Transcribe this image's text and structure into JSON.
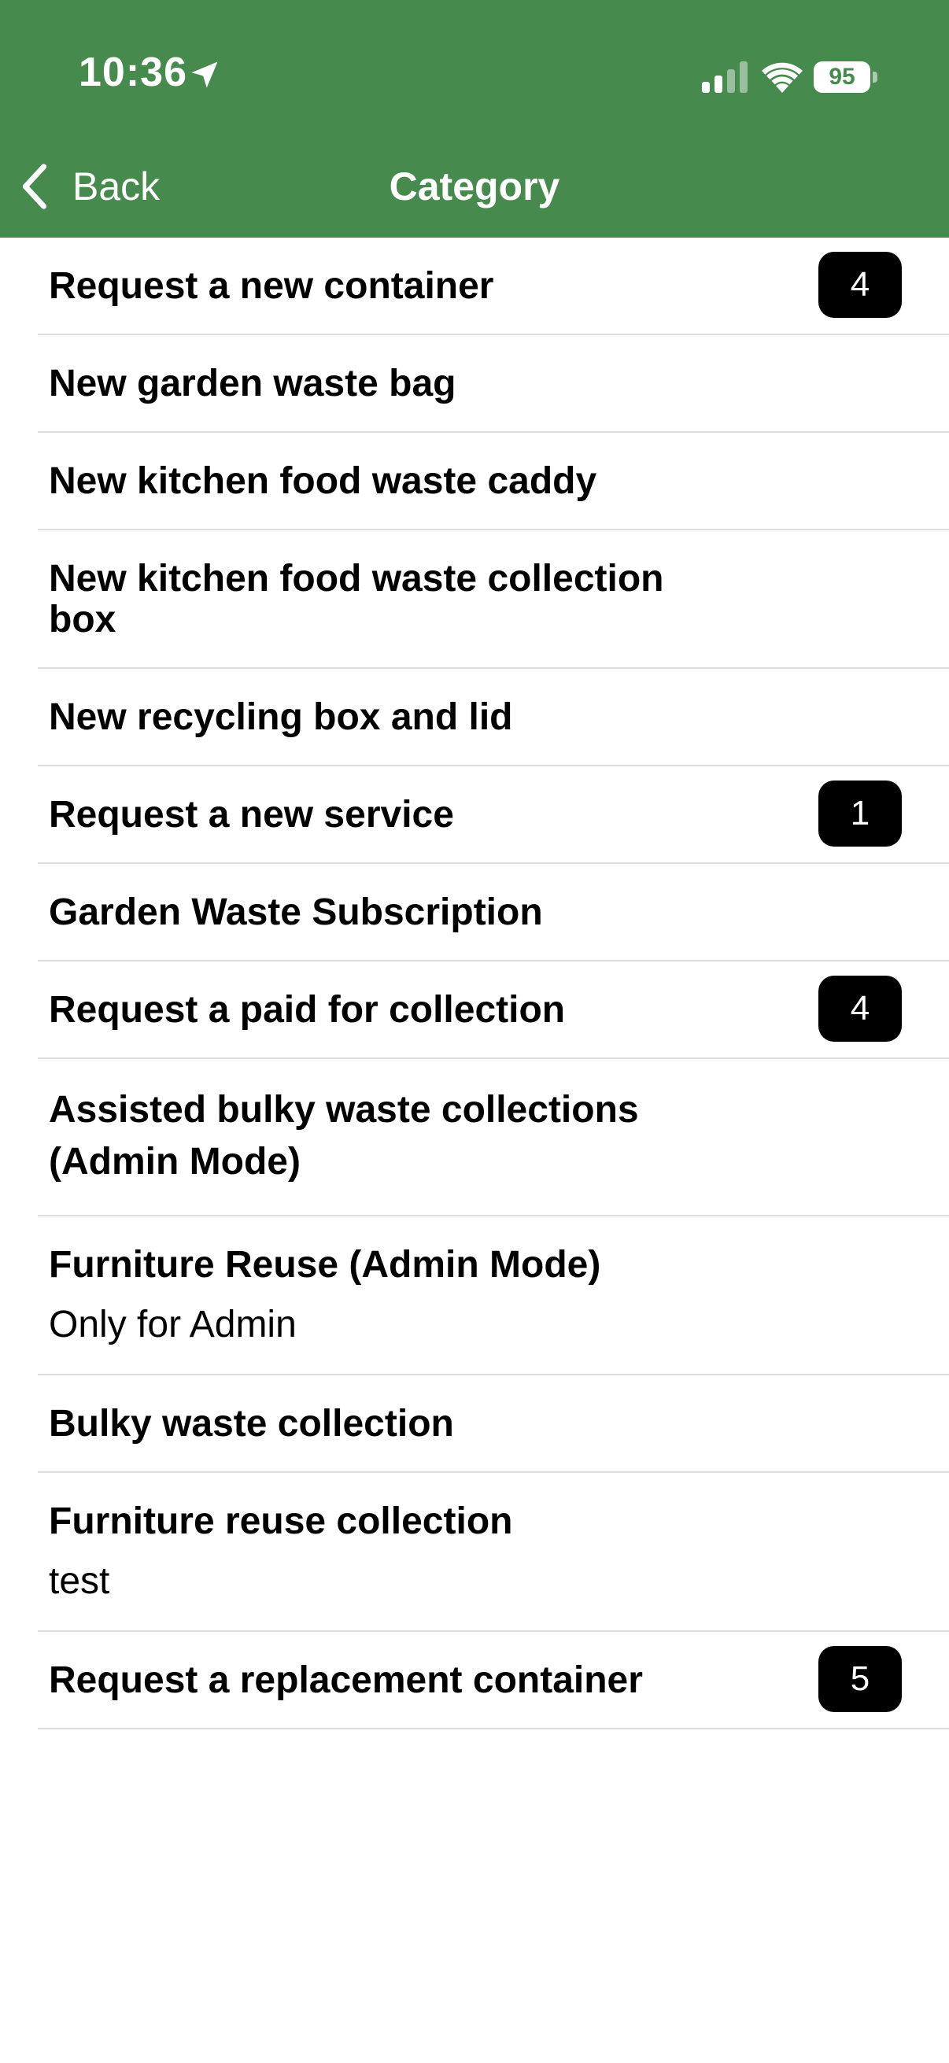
{
  "status_bar": {
    "time": "10:36",
    "battery": "95"
  },
  "nav": {
    "back_label": "Back",
    "title": "Category"
  },
  "colors": {
    "header": "#478A4E",
    "badge": "#000000",
    "divider": "#dcdcdc"
  },
  "icons": {
    "location": "location-arrow-icon",
    "cellular": "cellular-signal-icon",
    "wifi": "wifi-icon",
    "battery": "battery-icon",
    "back": "chevron-left-icon"
  },
  "categories": [
    {
      "title": "Request a new container",
      "badge": "4"
    },
    {
      "title": "New garden waste bag"
    },
    {
      "title": "New kitchen food waste caddy"
    },
    {
      "title": "New kitchen food waste collection box"
    },
    {
      "title": "New recycling box and lid"
    },
    {
      "title": "Request a new service",
      "badge": "1"
    },
    {
      "title": "Garden Waste Subscription"
    },
    {
      "title": "Request a paid for collection",
      "badge": "4"
    },
    {
      "title": "Assisted bulky waste collections (Admin Mode)"
    },
    {
      "title": "Furniture Reuse (Admin Mode)",
      "subtitle": "Only for Admin"
    },
    {
      "title": "Bulky waste collection"
    },
    {
      "title": "Furniture reuse collection",
      "subtitle": "test"
    },
    {
      "title": "Request a replacement container",
      "badge": "5"
    }
  ]
}
